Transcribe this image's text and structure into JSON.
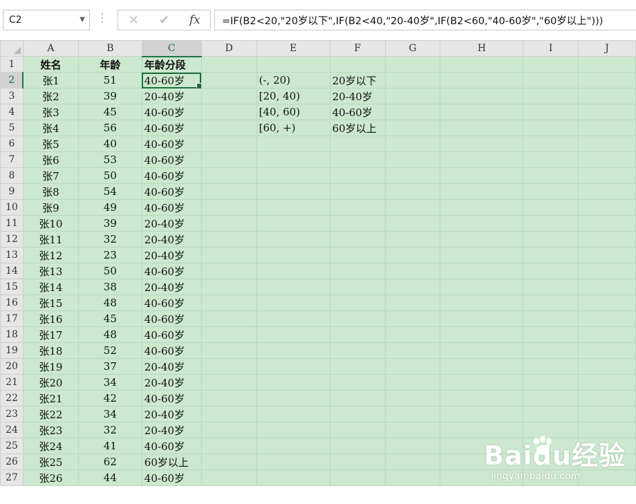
{
  "formula_bar": {
    "name_box": "C2",
    "cancel_glyph": "✕",
    "enter_glyph": "✔",
    "fx_label": "fx",
    "formula": "=IF(B2<20,\"20岁以下\",IF(B2<40,\"20-40岁\",IF(B2<60,\"40-60岁\",\"60岁以上\")))"
  },
  "columns": [
    "A",
    "B",
    "C",
    "D",
    "E",
    "F",
    "G",
    "H",
    "I",
    "J"
  ],
  "header_row": {
    "name": "姓名",
    "age": "年龄",
    "segment": "年龄分段"
  },
  "rows": [
    {
      "n": "2",
      "a": "张1",
      "b": "51",
      "c": "40-60岁"
    },
    {
      "n": "3",
      "a": "张2",
      "b": "39",
      "c": "20-40岁"
    },
    {
      "n": "4",
      "a": "张3",
      "b": "45",
      "c": "40-60岁"
    },
    {
      "n": "5",
      "a": "张4",
      "b": "56",
      "c": "40-60岁"
    },
    {
      "n": "6",
      "a": "张5",
      "b": "40",
      "c": "40-60岁"
    },
    {
      "n": "7",
      "a": "张6",
      "b": "53",
      "c": "40-60岁"
    },
    {
      "n": "8",
      "a": "张7",
      "b": "50",
      "c": "40-60岁"
    },
    {
      "n": "9",
      "a": "张8",
      "b": "54",
      "c": "40-60岁"
    },
    {
      "n": "10",
      "a": "张9",
      "b": "49",
      "c": "40-60岁"
    },
    {
      "n": "11",
      "a": "张10",
      "b": "39",
      "c": "20-40岁"
    },
    {
      "n": "12",
      "a": "张11",
      "b": "32",
      "c": "20-40岁"
    },
    {
      "n": "13",
      "a": "张12",
      "b": "23",
      "c": "20-40岁"
    },
    {
      "n": "14",
      "a": "张13",
      "b": "50",
      "c": "40-60岁"
    },
    {
      "n": "15",
      "a": "张14",
      "b": "38",
      "c": "20-40岁"
    },
    {
      "n": "16",
      "a": "张15",
      "b": "48",
      "c": "40-60岁"
    },
    {
      "n": "17",
      "a": "张16",
      "b": "45",
      "c": "40-60岁"
    },
    {
      "n": "18",
      "a": "张17",
      "b": "48",
      "c": "40-60岁"
    },
    {
      "n": "19",
      "a": "张18",
      "b": "52",
      "c": "40-60岁"
    },
    {
      "n": "20",
      "a": "张19",
      "b": "37",
      "c": "20-40岁"
    },
    {
      "n": "21",
      "a": "张20",
      "b": "34",
      "c": "20-40岁"
    },
    {
      "n": "22",
      "a": "张21",
      "b": "42",
      "c": "40-60岁"
    },
    {
      "n": "23",
      "a": "张22",
      "b": "34",
      "c": "20-40岁"
    },
    {
      "n": "24",
      "a": "张23",
      "b": "32",
      "c": "20-40岁"
    },
    {
      "n": "25",
      "a": "张24",
      "b": "41",
      "c": "40-60岁"
    },
    {
      "n": "26",
      "a": "张25",
      "b": "62",
      "c": "60岁以上"
    },
    {
      "n": "27",
      "a": "张26",
      "b": "44",
      "c": "40-60岁"
    }
  ],
  "lookup": [
    {
      "range": "(-, 20)",
      "label": "20岁以下"
    },
    {
      "range": "[20, 40)",
      "label": "20-40岁"
    },
    {
      "range": "[40, 60)",
      "label": "40-60岁"
    },
    {
      "range": "[60, +)",
      "label": "60岁以上"
    }
  ],
  "watermark": {
    "logo_text": "Baidu经验",
    "url": "jingyan.baidu.com"
  }
}
